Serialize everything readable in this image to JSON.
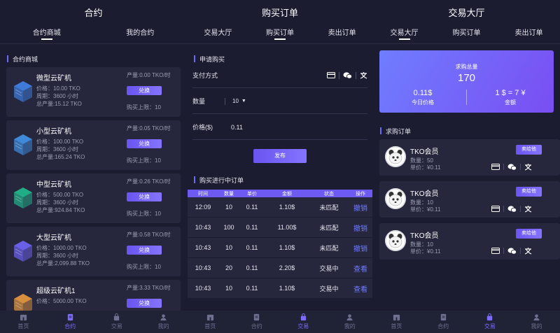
{
  "panels": {
    "contract": {
      "title": "合约",
      "tabs": [
        "合约商城",
        "我的合约"
      ],
      "section": "合约商城",
      "miners": [
        {
          "name": "微型云矿机",
          "production": "产量:0.00 TKO/时",
          "price": "价格：10.00 TKO",
          "period": "周期：3600 小时",
          "total": "总产量:15.12 TKO",
          "button": "兑换",
          "limit": "购买上限：10",
          "color": "#3f7fe0"
        },
        {
          "name": "小型云矿机",
          "production": "产量:0.05 TKO/时",
          "price": "价格：100.00 TKO",
          "period": "周期：3600 小时",
          "total": "总产量:165.24 TKO",
          "button": "兑换",
          "limit": "购买上限：10",
          "color": "#3f8ee0"
        },
        {
          "name": "中型云矿机",
          "production": "产量:0.26 TKO/时",
          "price": "价格：500.00 TKO",
          "period": "周期：3600 小时",
          "total": "总产量:924.84 TKO",
          "button": "兑换",
          "limit": "购买上限：10",
          "color": "#21b58a"
        },
        {
          "name": "大型云矿机",
          "production": "产量:0.58 TKO/时",
          "price": "价格：1000.00 TKO",
          "period": "周期：3600 小时",
          "total": "总产量:2,099.88 TKO",
          "button": "兑换",
          "limit": "购买上限：10",
          "color": "#6d63f0"
        },
        {
          "name": "超级云矿机1",
          "production": "产量:3.33 TKO/时",
          "price": "价格：5000.00 TKO",
          "period": "",
          "total": "",
          "button": "兑换",
          "limit": "",
          "color": "#e0953f"
        }
      ],
      "nav": [
        {
          "label": "首页",
          "icon": "home-icon"
        },
        {
          "label": "合约",
          "icon": "contract-icon"
        },
        {
          "label": "交易",
          "icon": "trade-icon"
        },
        {
          "label": "我的",
          "icon": "user-icon"
        }
      ]
    },
    "buy": {
      "title": "购买订单",
      "tabs": [
        "交易大厅",
        "购买订单",
        "卖出订单"
      ],
      "request_section": "申请购买",
      "payment_label": "支付方式",
      "quantity_label": "数量",
      "quantity_value": "10",
      "price_label": "价格($)",
      "price_value": "0.11",
      "publish_button": "发布",
      "orders_section": "购买进行中订单",
      "columns": [
        "时间",
        "数量",
        "单价",
        "金额",
        "状态",
        "操作"
      ],
      "rows": [
        {
          "time": "12:09",
          "qty": "10",
          "unit": "0.11",
          "amount": "1.10$",
          "status": "未匹配",
          "action": "撤销"
        },
        {
          "time": "10:43",
          "qty": "100",
          "unit": "0.11",
          "amount": "11.00$",
          "status": "未匹配",
          "action": "撤销"
        },
        {
          "time": "10:43",
          "qty": "10",
          "unit": "0.11",
          "amount": "1.10$",
          "status": "未匹配",
          "action": "撤销"
        },
        {
          "time": "10:43",
          "qty": "20",
          "unit": "0.11",
          "amount": "2.20$",
          "status": "交易中",
          "action": "查看"
        },
        {
          "time": "10:43",
          "qty": "10",
          "unit": "0.11",
          "amount": "1.10$",
          "status": "交易中",
          "action": "查看"
        }
      ],
      "nav": [
        {
          "label": "首页",
          "icon": "home-icon"
        },
        {
          "label": "合约",
          "icon": "contract-icon"
        },
        {
          "label": "交易",
          "icon": "trade-icon"
        },
        {
          "label": "我的",
          "icon": "user-icon"
        }
      ]
    },
    "hall": {
      "title": "交易大厅",
      "tabs": [
        "交易大厅",
        "购买订单",
        "卖出订单"
      ],
      "hero": {
        "total_label": "求购总量",
        "total_value": "170",
        "price_value": "0.11$",
        "price_label": "今日价格",
        "rate_value": "1 $ = 7 ¥",
        "rate_label": "金额"
      },
      "orders_section": "求购订单",
      "orders": [
        {
          "name": "TKO会员",
          "qty": "数量：50",
          "unit": "单价：¥0.11",
          "button": "卖给他"
        },
        {
          "name": "TKO会员",
          "qty": "数量：10",
          "unit": "单价：¥0.11",
          "button": "卖给他"
        },
        {
          "name": "TKO会员",
          "qty": "数量：10",
          "unit": "单价：¥0.11",
          "button": "卖给他"
        }
      ],
      "nav": [
        {
          "label": "首页",
          "icon": "home-icon"
        },
        {
          "label": "合约",
          "icon": "contract-icon"
        },
        {
          "label": "交易",
          "icon": "trade-icon"
        },
        {
          "label": "我的",
          "icon": "user-icon"
        }
      ]
    }
  },
  "colors": {
    "accent": "#6c5af3",
    "background": "#1b1c30",
    "card": "#26273d",
    "link": "#6f7bff"
  }
}
